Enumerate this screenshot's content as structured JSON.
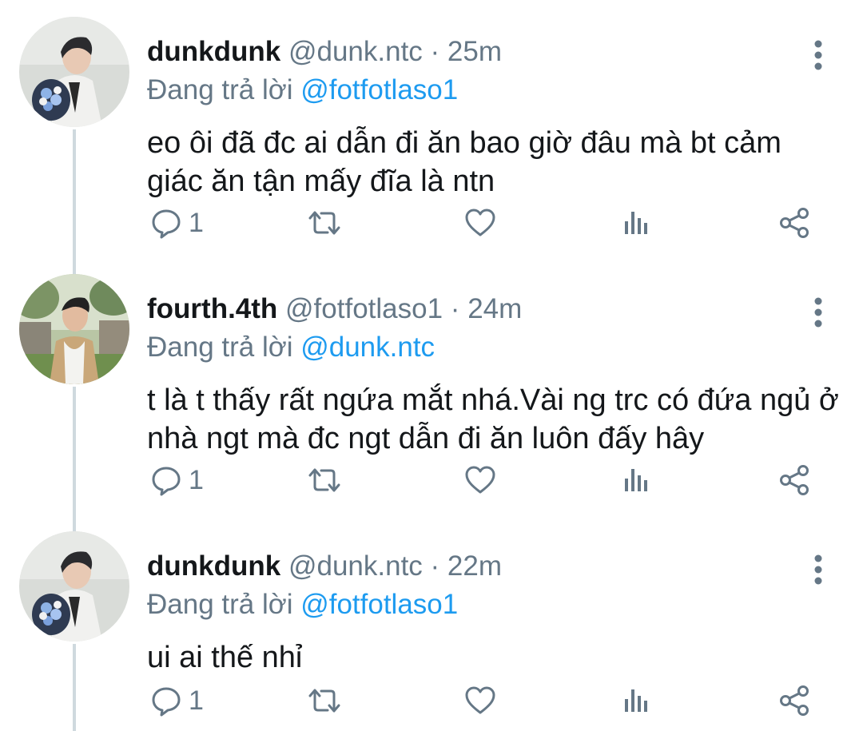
{
  "colors": {
    "text": "#14171a",
    "muted": "#657786",
    "mention": "#1d9bf0",
    "thread_line": "#cfd9de"
  },
  "tweets": [
    {
      "display_name": "dunkdunk",
      "handle": "@dunk.ntc",
      "separator": "·",
      "time": "25m",
      "replying_prefix": "Đang trả lời",
      "replying_to": "@fotfotlaso1",
      "text": "eo ôi đã đc ai dẫn đi ăn bao giờ đâu mà bt cảm giác ăn tận mấy đĩa là ntn",
      "reply_count": "1",
      "avatar_icon": "avatar-photo"
    },
    {
      "display_name": "fourth.4th",
      "handle": "@fotfotlaso1",
      "separator": "·",
      "time": "24m",
      "replying_prefix": "Đang trả lời",
      "replying_to": "@dunk.ntc",
      "text": "t là t thấy rất ngứa mắt nhá.Vài ng trc có đứa ngủ ở nhà ngt mà đc ngt dẫn đi ăn luôn đấy hây",
      "reply_count": "1",
      "avatar_icon": "avatar-photo"
    },
    {
      "display_name": "dunkdunk",
      "handle": "@dunk.ntc",
      "separator": "·",
      "time": "22m",
      "replying_prefix": "Đang trả lời",
      "replying_to": "@fotfotlaso1",
      "text": "ui ai thế nhỉ",
      "reply_count": "1",
      "avatar_icon": "avatar-photo"
    }
  ],
  "action_icons": [
    "reply-icon",
    "retweet-icon",
    "like-icon",
    "analytics-icon",
    "share-icon"
  ]
}
